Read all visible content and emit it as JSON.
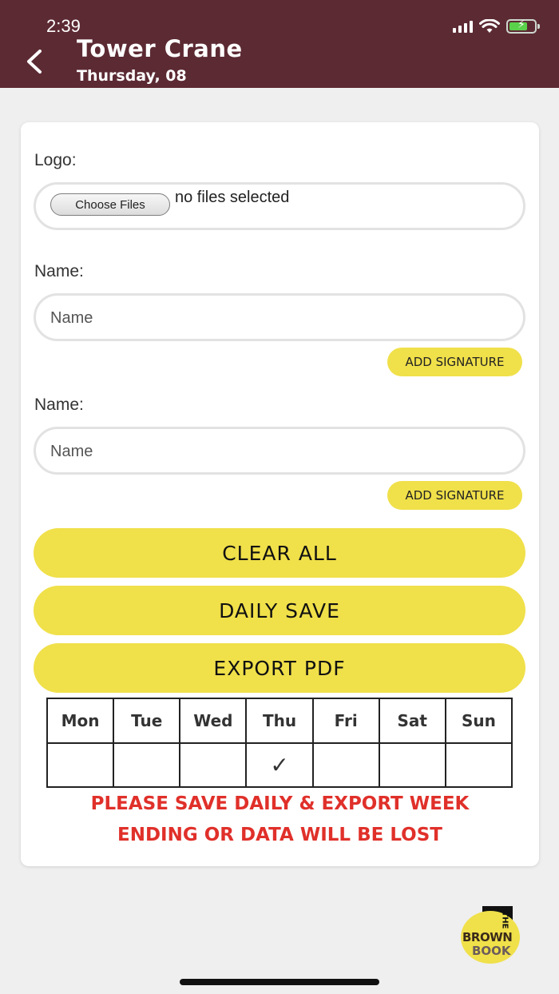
{
  "status_bar": {
    "time": "2:39",
    "icons": [
      "signal-icon",
      "wifi-icon",
      "battery-charging-icon"
    ]
  },
  "header": {
    "title": "Tower Crane",
    "subtitle": "Thursday, 08",
    "back_icon": "chevron-left-icon",
    "background_color": "#5c2a33"
  },
  "form": {
    "logo_label": "Logo:",
    "choose_files_label": "Choose Files",
    "no_files_text": "no files selected",
    "name1_label": "Name:",
    "name1_placeholder": "Name",
    "signature1_label": "ADD SIGNATURE",
    "name2_label": "Name:",
    "name2_placeholder": "Name",
    "signature2_label": "ADD SIGNATURE"
  },
  "actions": {
    "clear_all": "CLEAR ALL",
    "daily_save": "DAILY SAVE",
    "export_pdf": "EXPORT PDF",
    "accent_color": "#f0e04a"
  },
  "week": {
    "days": [
      "Mon",
      "Tue",
      "Wed",
      "Thu",
      "Fri",
      "Sat",
      "Sun"
    ],
    "marks": [
      "",
      "",
      "",
      "✓",
      "",
      "",
      ""
    ]
  },
  "warning": {
    "line1": "PLEASE SAVE DAILY & EXPORT WEEK",
    "line2": "ENDING OR DATA WILL BE LOST",
    "color": "#e0302a"
  },
  "brand_logo": {
    "the": "THE",
    "brown": "BROWN",
    "book": "BOOK"
  }
}
